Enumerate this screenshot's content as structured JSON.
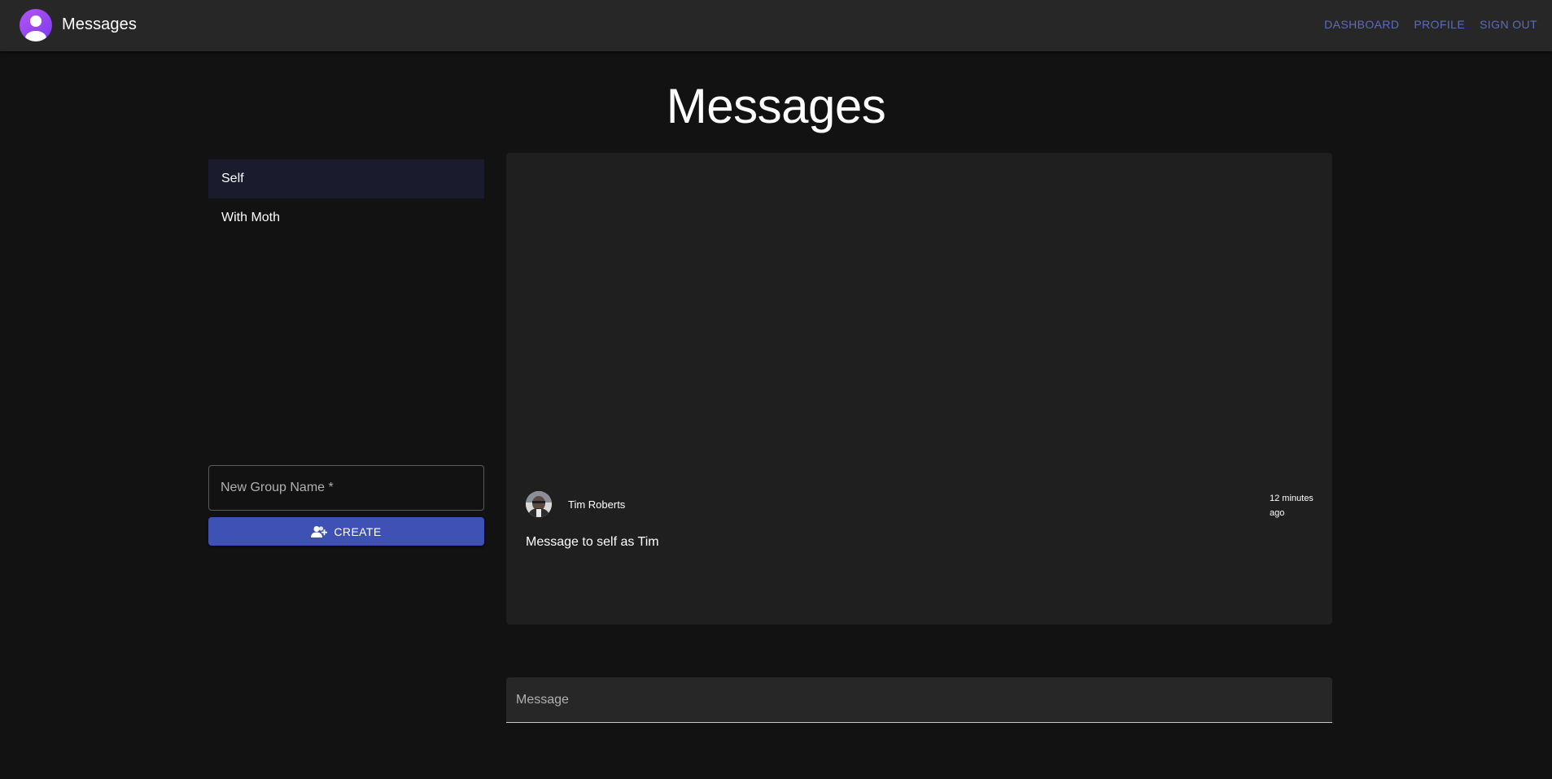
{
  "app": {
    "title": "Messages",
    "logo_icon": "account-circle-icon",
    "accent_color": "#3f51b5",
    "link_color": "#5c6bc0"
  },
  "nav": {
    "items": [
      {
        "label": "DASHBOARD"
      },
      {
        "label": "PROFILE"
      },
      {
        "label": "SIGN OUT"
      }
    ]
  },
  "page": {
    "heading": "Messages"
  },
  "groups": {
    "items": [
      {
        "label": "Self",
        "selected": true
      },
      {
        "label": "With Moth",
        "selected": false
      }
    ],
    "new_group_placeholder": "New Group Name *",
    "create_label": "CREATE",
    "create_icon": "group-add-icon"
  },
  "messages": [
    {
      "author": "Tim Roberts",
      "time": "12 minutes ago",
      "text": "Message to self as Tim",
      "avatar_icon": "user-avatar-photo"
    }
  ],
  "compose": {
    "placeholder": "Message"
  }
}
